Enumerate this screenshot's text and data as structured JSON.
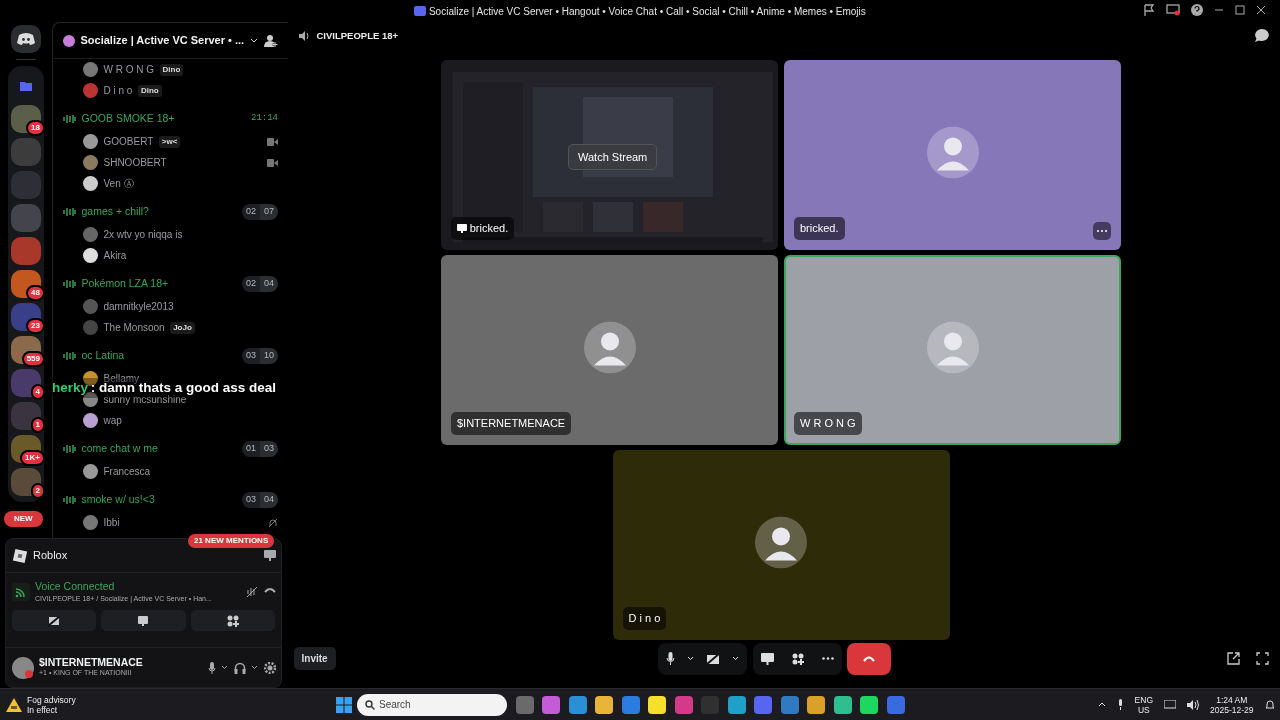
{
  "window": {
    "title": "Socialize | Active VC Server • Hangout • Voice Chat • Call • Social • Chill • Anime • Memes • Emojis"
  },
  "server_rail": {
    "items": [
      {
        "kind": "home",
        "color": "#2b2d31"
      },
      {
        "kind": "folder",
        "color": "#5865f2"
      },
      {
        "kind": "server",
        "color": "#5b5f4a",
        "badge": "18"
      },
      {
        "kind": "server",
        "color": "#3c3c3c"
      },
      {
        "kind": "server",
        "color": "#2e2e36"
      },
      {
        "kind": "server",
        "color": "#44444c"
      },
      {
        "kind": "server",
        "color": "#a8382a"
      },
      {
        "kind": "server",
        "color": "#c4571d",
        "badge": "48"
      },
      {
        "kind": "server",
        "color": "#3a3f8a",
        "badge": "23"
      },
      {
        "kind": "server",
        "color": "#8a6a4a",
        "badge": "559"
      },
      {
        "kind": "server",
        "color": "#4a3a6a",
        "badge": "4"
      },
      {
        "kind": "server",
        "color": "#3a3440",
        "badge": "1"
      },
      {
        "kind": "server",
        "color": "#6a5a2a",
        "badge": "1K+"
      },
      {
        "kind": "server",
        "color": "#5a4a3a",
        "badge": "2"
      }
    ],
    "new_label": "NEW"
  },
  "channel_panel": {
    "server_name": "Socialize | Active VC Server • ...",
    "top_members": [
      {
        "name": "W R O N G",
        "tag": "Dino"
      },
      {
        "name": "D i n o",
        "tag": "Dino"
      }
    ],
    "channels": [
      {
        "name": "GOOB SMOKE 18+",
        "timer": "21:14",
        "members": [
          {
            "name": "GOOBERT",
            "tag": ">w<",
            "kind": "video"
          },
          {
            "name": "SHNOOBERT",
            "kind": "video"
          },
          {
            "name": "Ven Ⓐ",
            "kind": "plain"
          }
        ]
      },
      {
        "name": "games + chill?",
        "users": "02",
        "limit": "07",
        "members": [
          {
            "name": "2x wtv yo niqqa is",
            "kind": "plain"
          },
          {
            "name": "Akira",
            "kind": "plain"
          }
        ]
      },
      {
        "name": "Pokémon LZA 18+",
        "users": "02",
        "limit": "04",
        "members": [
          {
            "name": "damnitkyle2013",
            "kind": "plain"
          },
          {
            "name": "The Monsoon",
            "tag": "JoJo",
            "kind": "plain"
          }
        ]
      },
      {
        "name": "oc Latina",
        "users": "03",
        "limit": "10",
        "members": [
          {
            "name": "Bellamy",
            "kind": "plain"
          },
          {
            "name": "sunny mcsunshine",
            "kind": "plain"
          },
          {
            "name": "wap",
            "kind": "plain"
          }
        ]
      },
      {
        "name": "come chat w me",
        "users": "01",
        "limit": "03",
        "members": [
          {
            "name": "Francesca",
            "kind": "plain"
          }
        ]
      },
      {
        "name": "smoke w/ us!<3",
        "users": "03",
        "limit": "04",
        "members": [
          {
            "name": "Ibbi",
            "kind": "muted"
          }
        ]
      }
    ],
    "mentions": "21 NEW MENTIONS"
  },
  "overlay_chat": {
    "user": "herky",
    "separator": ":",
    "message": "damn thats a good ass deal"
  },
  "activity": {
    "name": "Roblox"
  },
  "voice": {
    "status": "Voice Connected",
    "location": "CIVILPEOPLE 18+ / Socialize | Active VC Server • Han..."
  },
  "user": {
    "name": "$INTERNETMENACE",
    "status": "+1 • KING OF THE NATIONIII"
  },
  "call": {
    "channel": "CIVILPEOPLE 18+",
    "tiles": [
      {
        "name": "bricked.",
        "kind": "stream",
        "button": "Watch Stream",
        "speaking": false,
        "color": "#1b1b1f"
      },
      {
        "name": "bricked.",
        "kind": "avatar",
        "speaking": false,
        "color": "#8677b8",
        "more": true
      },
      {
        "name": "$INTERNETMENACE",
        "kind": "avatar",
        "speaking": false,
        "color": "#6b6b6b"
      },
      {
        "name": "W R O N G",
        "kind": "avatar",
        "speaking": true,
        "color": "#9ea0a8"
      },
      {
        "name": "D i n o",
        "kind": "avatar",
        "speaking": false,
        "color": "#2e2b09"
      }
    ],
    "invite": "Invite"
  },
  "taskbar": {
    "weather_title": "Fog advisory",
    "weather_sub": "In effect",
    "search_placeholder": "Search",
    "apps": [
      {
        "color": "#6a6a6a"
      },
      {
        "color": "#c45cd8"
      },
      {
        "color": "#2b8fd6"
      },
      {
        "color": "#e8b43a"
      },
      {
        "color": "#2c7be0"
      },
      {
        "color": "#f4e02a"
      },
      {
        "color": "#d43a8a"
      },
      {
        "color": "#303030"
      },
      {
        "color": "#1fa0c8"
      },
      {
        "color": "#5865f2"
      },
      {
        "color": "#2f7ac0"
      },
      {
        "color": "#d9a02a"
      },
      {
        "color": "#2fbf8f"
      },
      {
        "color": "#1ed760"
      },
      {
        "color": "#3a6ae0"
      }
    ],
    "lang": "ENG",
    "region": "US",
    "time": "1:24 AM",
    "date": "2025-12-29"
  }
}
